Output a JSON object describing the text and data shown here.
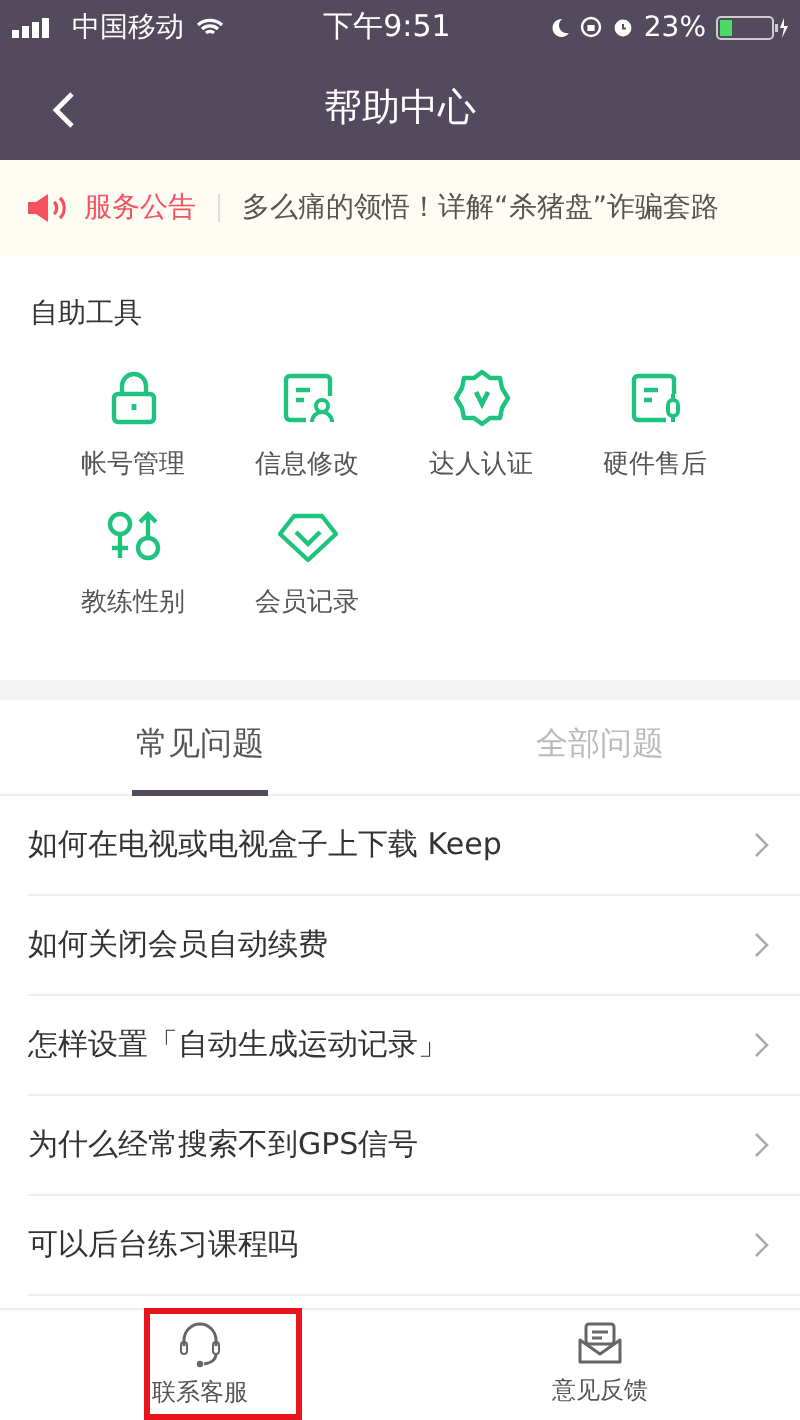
{
  "status_bar": {
    "carrier": "中国移动",
    "time": "下午9:51",
    "battery": "23%"
  },
  "nav": {
    "title": "帮助中心"
  },
  "notice": {
    "label": "服务公告",
    "text": "多么痛的领悟！详解“杀猪盘”诈骗套路"
  },
  "tools": {
    "title": "自助工具",
    "items": [
      {
        "label": "帐号管理",
        "kind": "lock"
      },
      {
        "label": "信息修改",
        "kind": "profile"
      },
      {
        "label": "达人认证",
        "kind": "badge"
      },
      {
        "label": "硬件售后",
        "kind": "device"
      },
      {
        "label": "教练性别",
        "kind": "gender"
      },
      {
        "label": "会员记录",
        "kind": "diamond"
      }
    ]
  },
  "tabs": [
    {
      "label": "常见问题",
      "selected": true
    },
    {
      "label": "全部问题",
      "selected": false
    }
  ],
  "questions": [
    "如何在电视或电视盒子上下载 Keep",
    "如何关闭会员自动续费",
    "怎样设置「自动生成运动记录」",
    "为什么经常搜索不到GPS信号",
    "可以后台练习课程吗"
  ],
  "bottom_bar": [
    {
      "label": "联系客服",
      "kind": "headset"
    },
    {
      "label": "意见反馈",
      "kind": "feedback"
    }
  ]
}
